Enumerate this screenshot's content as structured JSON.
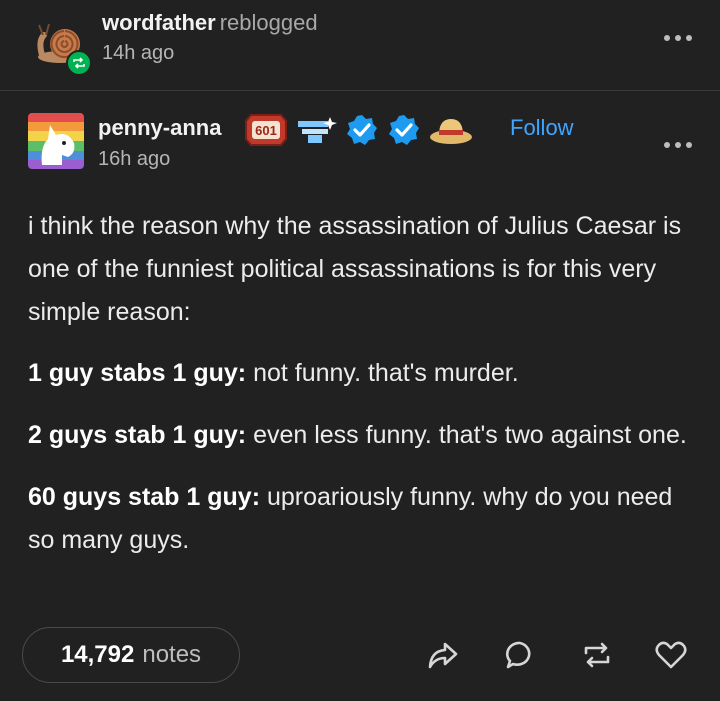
{
  "reblog": {
    "username": "wordfather",
    "action": "reblogged",
    "time": "14h ago"
  },
  "post": {
    "author": "penny-anna",
    "time": "16h ago",
    "badge_number": "601",
    "follow_label": "Follow",
    "intro": "i think the reason why the assassination of Julius Caesar is one of the funniest political assassinations is for this very simple reason:",
    "items": [
      {
        "bold": "1 guy stabs 1 guy:",
        "text": " not funny. that's murder."
      },
      {
        "bold": "2 guys stab 1 guy:",
        "text": " even less funny. that's two against one."
      },
      {
        "bold": "60 guys stab 1 guy:",
        "text": " uproariously funny. why do you need so many guys."
      }
    ]
  },
  "footer": {
    "notes_count": "14,792",
    "notes_label": "notes"
  },
  "colors": {
    "background": "#212121",
    "follow": "#3ea6ff",
    "reblog_green": "#00b352",
    "verified_blue": "#1d9bf0"
  },
  "icons": [
    "snail-avatar",
    "reblog-icon",
    "more-options-icon",
    "pony-avatar",
    "badge-601-icon",
    "sparkle-badge-icon",
    "verified-check-icon",
    "straw-hat-icon",
    "share-icon",
    "comment-icon",
    "heart-icon"
  ]
}
